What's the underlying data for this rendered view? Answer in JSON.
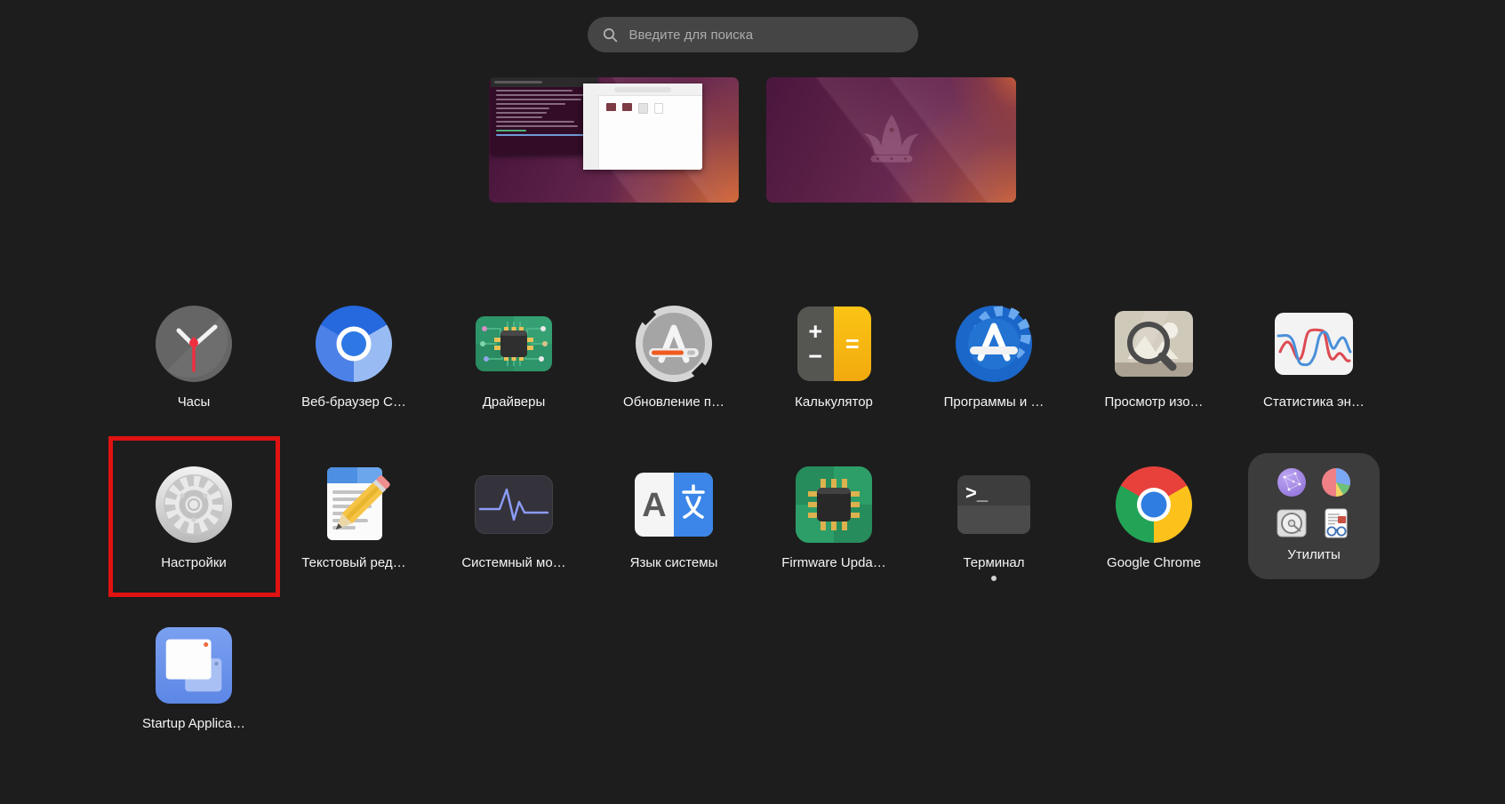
{
  "search": {
    "placeholder": "Введите для поиска"
  },
  "apps": [
    {
      "label": "Часы"
    },
    {
      "label": "Веб-браузер C…"
    },
    {
      "label": "Драйверы"
    },
    {
      "label": "Обновление п…"
    },
    {
      "label": "Калькулятор"
    },
    {
      "label": "Программы и …"
    },
    {
      "label": "Просмотр изо…"
    },
    {
      "label": "Статистика эн…"
    },
    {
      "label": "Настройки",
      "highlighted": true
    },
    {
      "label": "Текстовый ред…"
    },
    {
      "label": "Системный мо…"
    },
    {
      "label": "Язык системы"
    },
    {
      "label": "Firmware Upda…"
    },
    {
      "label": "Терминал",
      "running": true
    },
    {
      "label": "Google Chrome"
    },
    {
      "label": "Утилиты",
      "type": "folder"
    },
    {
      "label": "Startup Applica…"
    }
  ],
  "glyphs": {
    "calculator_plus": "+",
    "calculator_minus": "−",
    "calculator_equals": "=",
    "language_left": "A",
    "language_right": "文",
    "terminal_prompt": ">_"
  },
  "colors": {
    "background": "#1d1d1d",
    "highlight_red": "#e01212",
    "folder_bg": "#3c3c3c",
    "label_text": "#f5f5f5",
    "accent_orange": "#e0692f"
  }
}
